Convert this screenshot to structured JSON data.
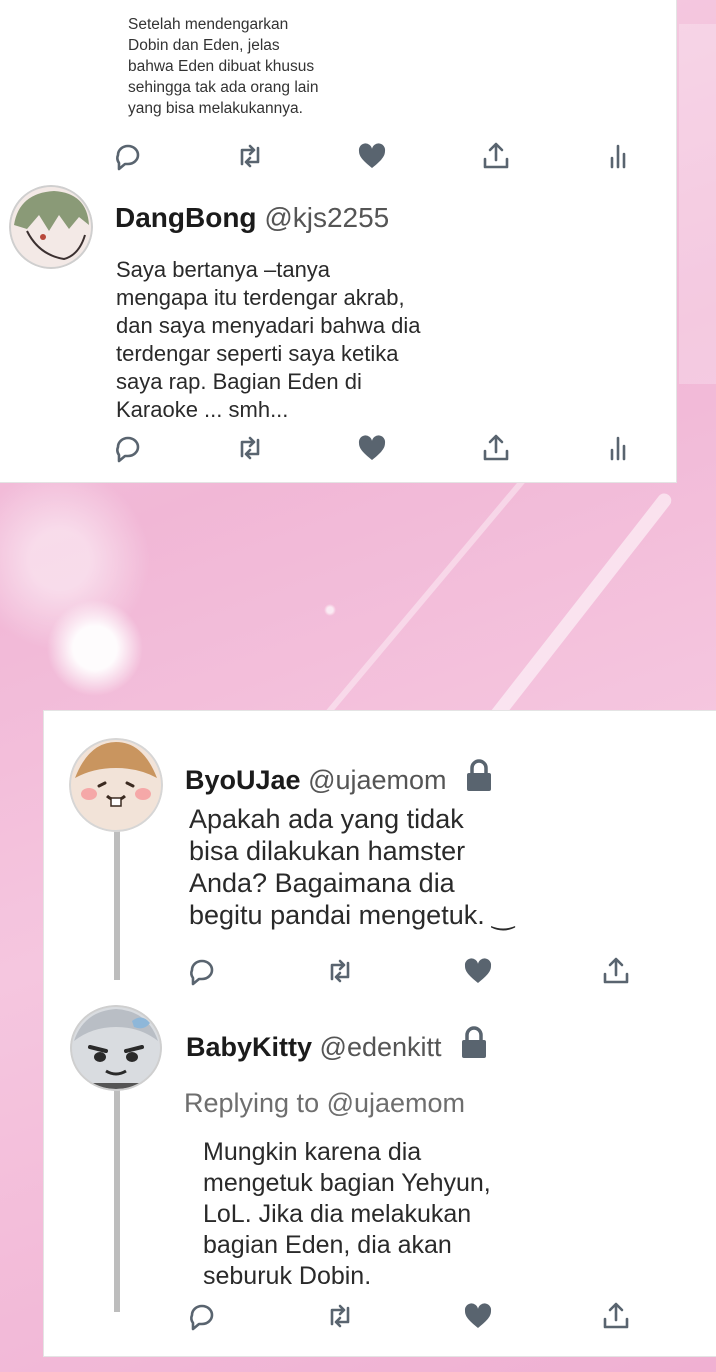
{
  "tweet_top": {
    "text": "Setelah mendengarkan\nDobin dan Eden, jelas\nbahwa Eden dibuat  khusus\nsehingga tak ada orang lain\nyang bisa melakukannya."
  },
  "tweet_dangbong": {
    "display_name": "DangBong",
    "handle": "@kjs2255",
    "text": "Saya bertanya –tanya\nmengapa itu terdengar akrab,\ndan saya menyadari bahwa dia\nterdengar seperti saya ketika\nsaya rap. Bagian Eden di\nKaraoke ... smh..."
  },
  "tweet_byoujae": {
    "display_name": "ByoUJae",
    "handle": "@ujaemom",
    "text": "Apakah ada yang tidak\nbisa dilakukan hamster\nAnda? Bagaimana dia\nbegitu pandai mengetuk.   ‿"
  },
  "tweet_babykitty": {
    "display_name": "BabyKitty",
    "handle": "@edenkitt",
    "replying_label": "Replying to @ujaemom",
    "text": "Mungkin karena dia\nmengetuk bagian Yehyun,\nLoL. Jika dia melakukan\nbagian Eden, dia akan\nseburuk Dobin."
  },
  "icons": {
    "reply": "reply-icon",
    "retweet": "retweet-icon",
    "like": "heart-icon",
    "share": "share-icon",
    "analytics": "analytics-icon",
    "lock": "lock-icon"
  },
  "colors": {
    "icon": "#59646f",
    "background_pink": "#f3bfdc"
  }
}
